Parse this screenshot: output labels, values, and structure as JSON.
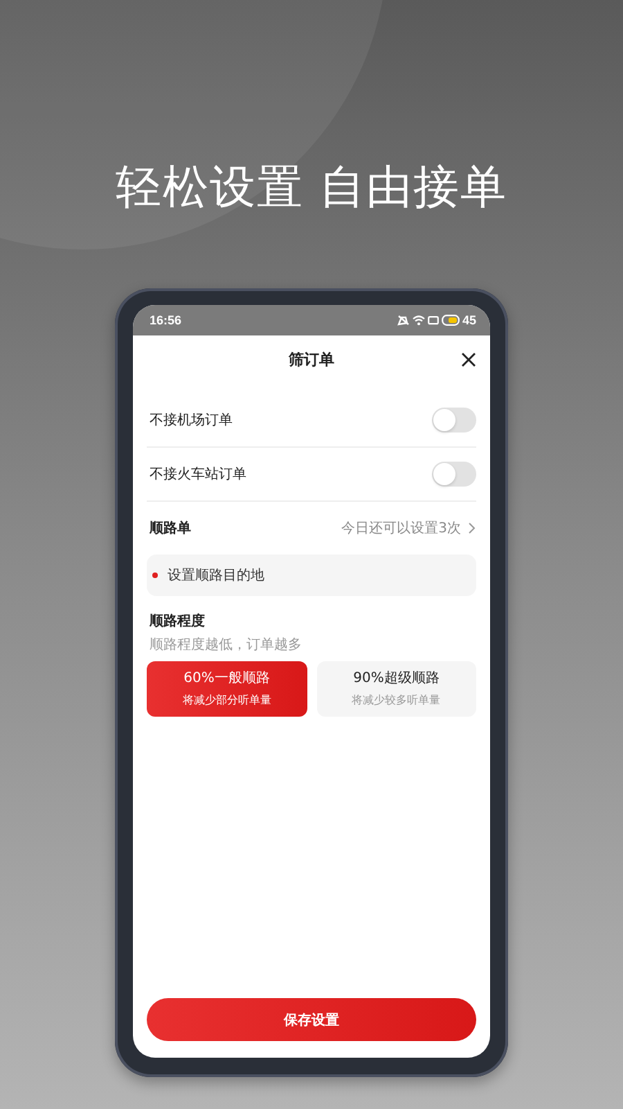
{
  "headline": "轻松设置 自由接单",
  "status_bar": {
    "time": "16:56",
    "battery": "45"
  },
  "sheet": {
    "title": "筛订单"
  },
  "toggles": [
    {
      "label": "不接机场订单",
      "on": false
    },
    {
      "label": "不接火车站订单",
      "on": false
    }
  ],
  "route": {
    "title": "顺路单",
    "hint": "今日还可以设置3次",
    "destination": "设置顺路目的地"
  },
  "degree": {
    "title": "顺路程度",
    "subtitle": "顺路程度越低，订单越多",
    "options": [
      {
        "label": "60%一般顺路",
        "note": "将减少部分听单量",
        "selected": true
      },
      {
        "label": "90%超级顺路",
        "note": "将减少较多听单量",
        "selected": false
      }
    ]
  },
  "save_button": "保存设置"
}
